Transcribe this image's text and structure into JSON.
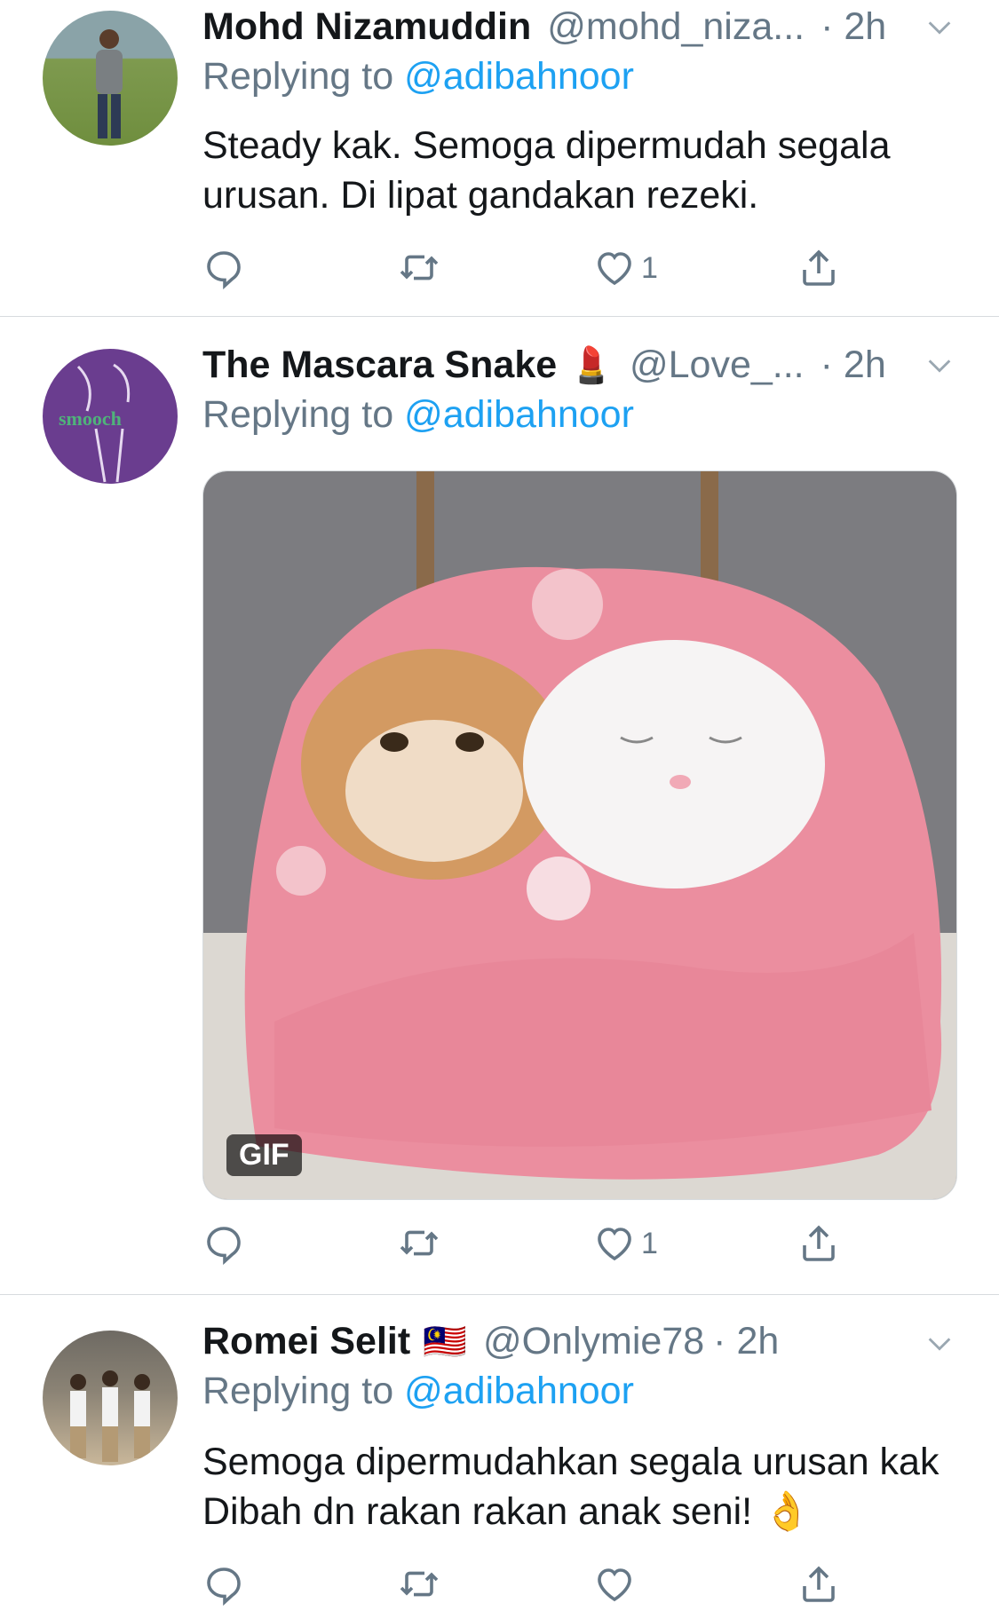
{
  "tweets": [
    {
      "name": "Mohd Nizamuddin",
      "name_emoji": "",
      "handle": "@mohd_niza...",
      "time": "· 2h",
      "replying_prefix": "Replying to ",
      "replying_handle": "@adibahnoor",
      "text": "Steady kak. Semoga dipermudah segala urusan. Di lipat gandakan rezeki.",
      "like_count": "1"
    },
    {
      "name": "The Mascara Snake",
      "name_emoji": "💄",
      "handle": "@Love_...",
      "time": "· 2h",
      "replying_prefix": "Replying to ",
      "replying_handle": "@adibahnoor",
      "media_badge": "GIF",
      "avatar_text": "smooch",
      "like_count": "1"
    },
    {
      "name": "Romei Selit",
      "name_emoji": "🇲🇾",
      "handle": "@Onlymie78",
      "time": "· 2h",
      "replying_prefix": "Replying to ",
      "replying_handle": "@adibahnoor",
      "text": "Semoga dipermudahkan segala urusan kak Dibah dn rakan rakan anak seni! 👌",
      "like_count": ""
    }
  ],
  "colors": {
    "link": "#1da1f2",
    "secondary": "#657786",
    "divider": "#d7dbde"
  },
  "icons": [
    "reply-icon",
    "retweet-icon",
    "like-icon",
    "share-icon",
    "chevron-down-icon"
  ]
}
